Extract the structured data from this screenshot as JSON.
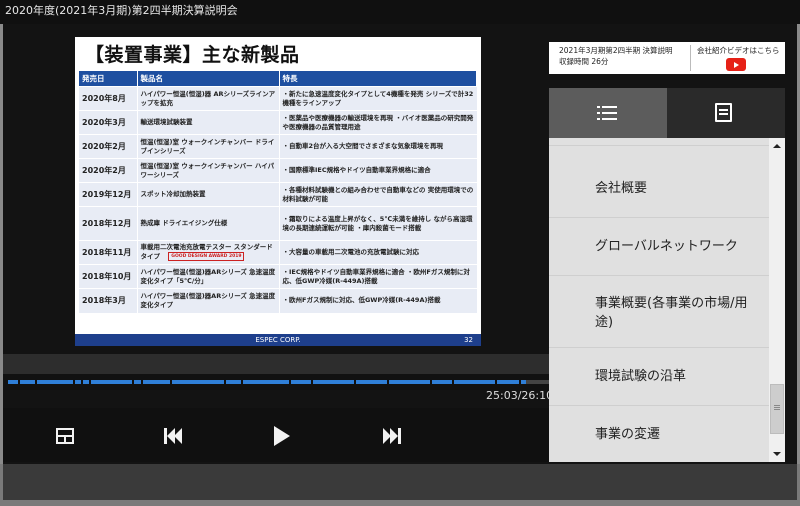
{
  "window": {
    "title": "2020年度(2021年3月期)第2四半期決算説明会"
  },
  "slide": {
    "heading": "【装置事業】主な新製品",
    "columns": [
      "発売日",
      "製品名",
      "特長"
    ],
    "rows": [
      {
        "date": "2020年8月",
        "name": "ハイパワー恒温(恒湿)器 ARシリーズラインアップを拡充",
        "feature": "・新たに急速温度変化タイプとして4機種を発売 シリーズで計32機種をラインアップ"
      },
      {
        "date": "2020年3月",
        "name": "輸送環境試験装置",
        "feature": "・医薬品や医療機器の輸送環境を再現 ・バイオ医薬品の研究開発や医療機器の品質管理用途"
      },
      {
        "date": "2020年2月",
        "name": "恒温(恒湿)室 ウォークインチャンバー ドライブインシリーズ",
        "feature": "・自動車2台が入る大空間でさまざまな気象環境を再現"
      },
      {
        "date": "2020年2月",
        "name": "恒温(恒湿)室 ウォークインチャンバー ハイパワーシリーズ",
        "feature": "・国際標準IEC規格やドイツ自動車業界規格に適合"
      },
      {
        "date": "2019年12月",
        "name": "スポット冷却加熱装置",
        "feature": "・各種材料試験機との組み合わせで自動車などの 実使用環境での材料試験が可能"
      },
      {
        "date": "2018年12月",
        "name": "熟成庫 ドライエイジング仕様",
        "feature": "・霜取りによる温度上昇がなく、5℃未満を維持し ながら高湿環境の長期連続運転が可能 ・庫内殺菌モード搭載"
      },
      {
        "date": "2018年11月",
        "name": "車載用二次電池充放電テスター スタンダードタイプ",
        "feature": "・大容量の車載用二次電池の充放電試験に対応",
        "award": "GOOD DESIGN AWARD 2019"
      },
      {
        "date": "2018年10月",
        "name": "ハイパワー恒温(恒湿)器ARシリーズ 急速温度変化タイプ「5℃/分」",
        "feature": "・IEC規格やドイツ自動車業界規格に適合 ・欧州Fガス規制に対応、低GWP冷媒(R-449A)搭載"
      },
      {
        "date": "2018年3月",
        "name": "ハイパワー恒温(恒湿)器ARシリーズ 急速温度変化タイプ",
        "feature": "・欧州Fガス規制に対応、低GWP冷媒(R-449A)搭載"
      }
    ],
    "footer_brand": "ESPEC CORP.",
    "page_number": "32"
  },
  "player": {
    "timecode": "25:03/26:10",
    "progress": 0.957,
    "accent_color": "#2f7fd8",
    "controls": {
      "layout": "layout-icon",
      "prev": "skip-previous-icon",
      "play": "play-icon",
      "next": "skip-next-icon"
    }
  },
  "side_panel": {
    "ad": {
      "line1": "2021年3月期第2四半期 決算説明",
      "line2": "収録時間 26分",
      "link_text": "会社紹介ビデオはこちら",
      "icon": "youtube-icon"
    },
    "tabs": [
      {
        "icon": "list-icon",
        "active": true
      },
      {
        "icon": "notes-icon",
        "active": false
      }
    ],
    "chapters": [
      "会社概要",
      "グローバルネットワーク",
      "事業概要(各事業の市場/用途)",
      "環境試験の沿革",
      "事業の変遷"
    ]
  }
}
